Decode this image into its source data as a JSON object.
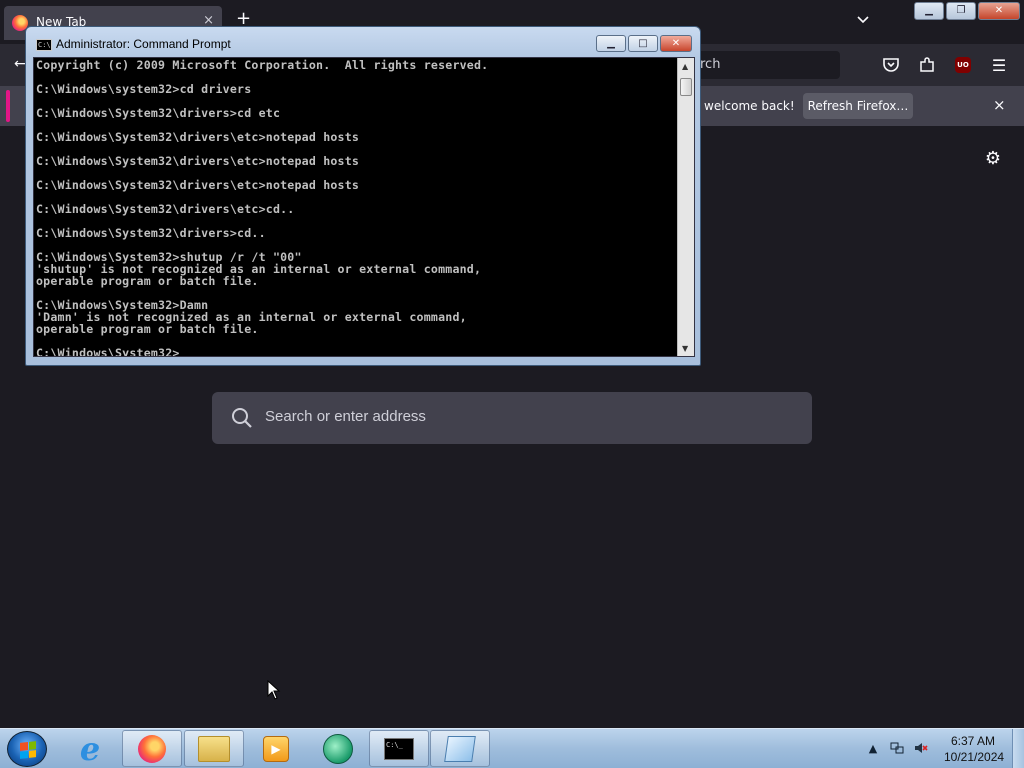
{
  "firefox": {
    "tab_title": "New Tab",
    "tab_close": "×",
    "new_tab": "+",
    "urlbar_text": "rch",
    "notification": {
      "text": "welcome back!",
      "button": "Refresh Firefox…",
      "close": "×"
    },
    "search_placeholder": "Search or enter address",
    "nav_icons": [
      "pocket-icon",
      "extensions-icon",
      "ublock-icon",
      "menu-icon"
    ],
    "ublock_label": "UO"
  },
  "cmd": {
    "title": "Administrator: Command Prompt",
    "lines": [
      "Copyright (c) 2009 Microsoft Corporation.  All rights reserved.",
      "",
      "C:\\Windows\\system32>cd drivers",
      "",
      "C:\\Windows\\System32\\drivers>cd etc",
      "",
      "C:\\Windows\\System32\\drivers\\etc>notepad hosts",
      "",
      "C:\\Windows\\System32\\drivers\\etc>notepad hosts",
      "",
      "C:\\Windows\\System32\\drivers\\etc>notepad hosts",
      "",
      "C:\\Windows\\System32\\drivers\\etc>cd..",
      "",
      "C:\\Windows\\System32\\drivers>cd..",
      "",
      "C:\\Windows\\System32>shutup /r /t \"00\"",
      "'shutup' is not recognized as an internal or external command,",
      "operable program or batch file.",
      "",
      "C:\\Windows\\System32>Damn",
      "'Damn' is not recognized as an internal or external command,",
      "operable program or batch file.",
      "",
      "C:\\Windows\\System32>_"
    ]
  },
  "taskbar": {
    "apps": [
      "internet-explorer",
      "firefox",
      "windows-explorer",
      "media-player",
      "app-dolphin",
      "command-prompt",
      "notepad"
    ],
    "cmd_icon_text": "C:\\_",
    "time": "6:37 AM",
    "date": "10/21/2024"
  },
  "colors": {
    "firefox_bg": "#1c1b22",
    "firefox_toolbar": "#2b2a33",
    "firefox_panel": "#42414d",
    "console_bg": "#000000",
    "console_fg": "#c0c0c0"
  }
}
